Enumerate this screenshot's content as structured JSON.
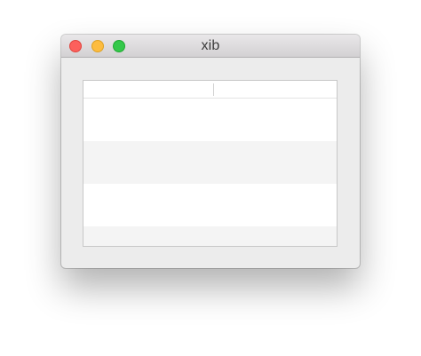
{
  "window": {
    "title": "xib"
  },
  "table": {
    "columns": [
      "",
      ""
    ],
    "rows": [
      [
        "",
        ""
      ],
      [
        "",
        ""
      ],
      [
        "",
        ""
      ],
      [
        "",
        ""
      ]
    ]
  },
  "colors": {
    "close": "#fc605c",
    "minimize": "#fdbc40",
    "zoom": "#34c84a",
    "window_bg": "#ececec",
    "alt_row": "#f4f4f4"
  }
}
